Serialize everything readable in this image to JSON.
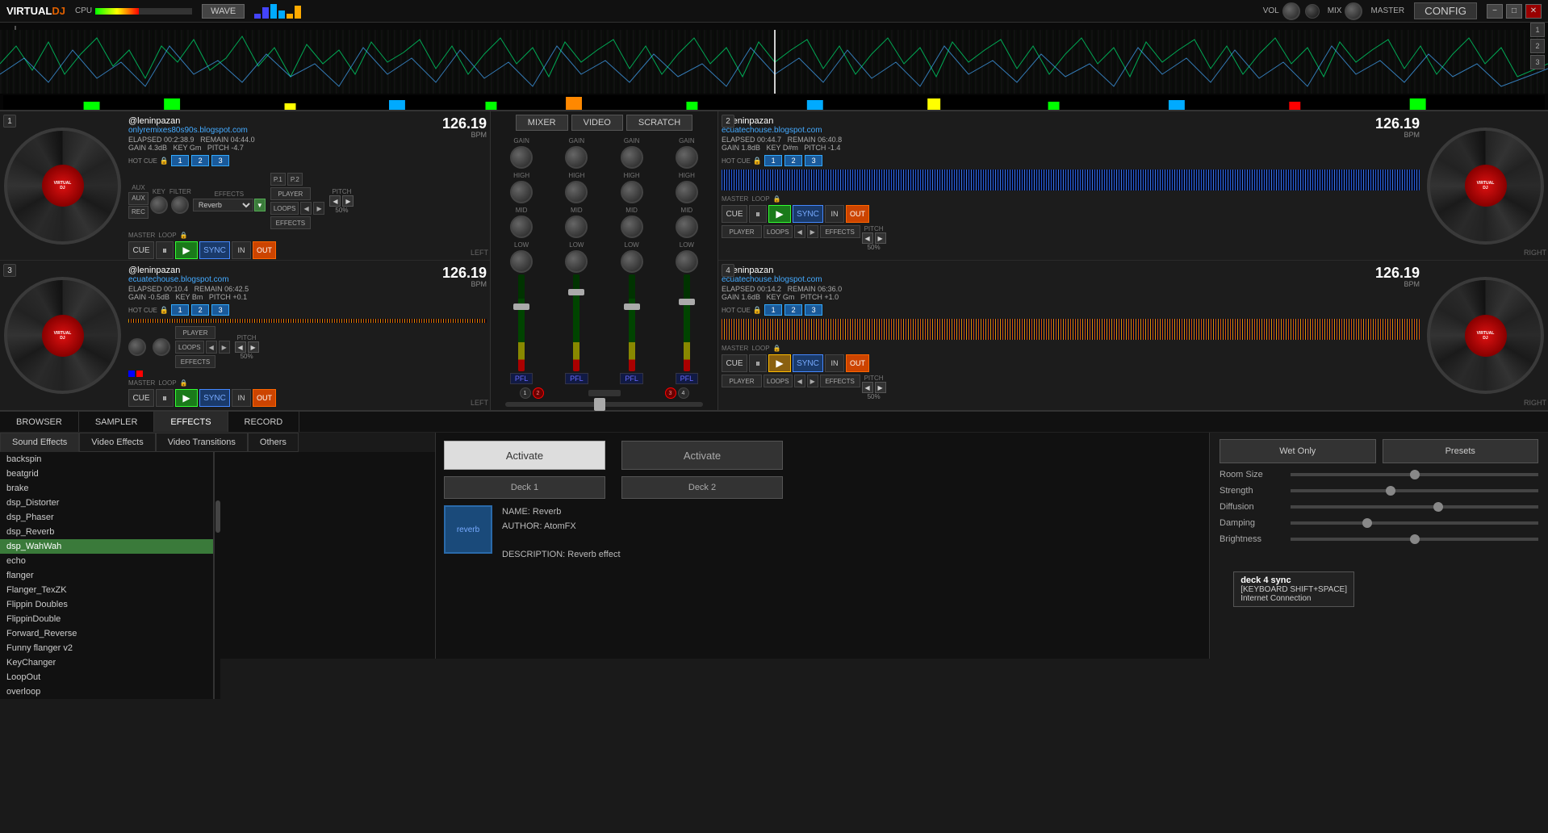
{
  "app": {
    "title": "VirtualDJ",
    "logo_part1": "VIRTUAL",
    "logo_part2": "DJ"
  },
  "topbar": {
    "cpu_label": "CPU",
    "wave_label": "WAVE",
    "vol_label": "VOL",
    "mix_label": "MIX",
    "master_label": "MASTER",
    "config_label": "CONFIG"
  },
  "mixer_tabs": {
    "mixer": "MIXER",
    "video": "VIDEO",
    "scratch": "SCRATCH"
  },
  "deck1": {
    "number": "1",
    "artist": "@leninpazan",
    "url": "onlyremixes80s90s.blogspot.com",
    "elapsed": "ELAPSED 00:2:38.9",
    "remain": "REMAIN 04:44.0",
    "gain": "GAIN 4.3dB",
    "key": "KEY Gm",
    "pitch": "PITCH -4.7",
    "bpm": "126.19",
    "bpm_unit": "BPM",
    "hot_cue": "HOT CUE",
    "hc1": "1",
    "hc2": "2",
    "hc3": "3",
    "effects_label": "EFFECTS",
    "effects_value": "Reverb",
    "label": "LEFT",
    "player_label": "PLAYER",
    "loops_label": "LOOPS",
    "effects_sub": "EFFECTS",
    "pitch_pct": "50%",
    "master_label": "MASTER",
    "loop_label": "LOOP",
    "cue_btn": "CUE",
    "in_btn": "IN",
    "out_btn": "OUT",
    "sync_btn": "SYNC",
    "p1_label": "P.1",
    "p2_label": "P.2",
    "key_label": "KEY",
    "filter_label": "FILTER",
    "aux_label": "AUX",
    "rec_label": "REC"
  },
  "deck2": {
    "number": "2",
    "artist": "@leninpazan",
    "url": "ecuatechouse.blogspot.com",
    "elapsed": "ELAPSED 00:44.7",
    "remain": "REMAIN 06:40.8",
    "gain": "GAIN 1.8dB",
    "key": "KEY D#m",
    "pitch": "PITCH -1.4",
    "bpm": "126.19",
    "bpm_unit": "BPM",
    "hot_cue": "HOT CUE",
    "hc1": "1",
    "hc2": "2",
    "hc3": "3",
    "label": "RIGHT",
    "player_label": "PLAYER",
    "loops_label": "LOOPS",
    "effects_sub": "EFFECTS",
    "pitch_pct": "50%",
    "master_label": "MASTER",
    "loop_label": "LOOP",
    "cue_btn": "CUE",
    "in_btn": "IN",
    "out_btn": "OUT",
    "sync_btn": "SYNC"
  },
  "deck3": {
    "number": "3",
    "artist": "@leninpazan",
    "url": "ecuatechouse.blogspot.com",
    "elapsed": "ELAPSED 00:10.4",
    "remain": "REMAIN 06:42.5",
    "gain": "GAIN -0.5dB",
    "key": "KEY Bm",
    "pitch": "PITCH +0.1",
    "bpm": "126.19",
    "bpm_unit": "BPM",
    "hot_cue": "HOT CUE",
    "hc1": "1",
    "hc2": "2",
    "hc3": "3",
    "label": "LEFT",
    "player_label": "PLAYER",
    "loops_label": "LOOPS",
    "effects_sub": "EFFECTS",
    "pitch_pct": "50%",
    "master_label": "MASTER",
    "loop_label": "LOOP",
    "cue_btn": "CUE",
    "in_btn": "IN",
    "out_btn": "OUT",
    "sync_btn": "SYNC"
  },
  "deck4": {
    "number": "4",
    "artist": "@leninpazan",
    "url": "ecuatechouse.blogspot.com",
    "elapsed": "ELAPSED 00:14.2",
    "remain": "REMAIN 06:36.0",
    "gain": "GAIN 1.6dB",
    "key": "KEY Gm",
    "pitch": "PITCH +1.0",
    "bpm": "126.19",
    "bpm_unit": "BPM",
    "hot_cue": "HOT CUE",
    "hc1": "1",
    "hc2": "2",
    "hc3": "3",
    "label": "RIGHT",
    "player_label": "PLAYER",
    "loops_label": "LOOPS",
    "effects_sub": "EFFECTS",
    "pitch_pct": "50%",
    "master_label": "MASTER",
    "loop_label": "LOOP",
    "cue_btn": "CUE",
    "in_btn": "IN",
    "out_btn": "OUT",
    "sync_btn": "SYNC"
  },
  "mixer": {
    "gain_label": "GAIN",
    "high_label": "HIGH",
    "mid_label": "MID",
    "low_label": "LOW",
    "pfl_label": "PFL",
    "ch1": "1",
    "ch2": "2",
    "ch3": "3",
    "ch4": "4"
  },
  "bottom_tabs": [
    {
      "label": "BROWSER",
      "active": false
    },
    {
      "label": "SAMPLER",
      "active": false
    },
    {
      "label": "EFFECTS",
      "active": true
    },
    {
      "label": "RECORD",
      "active": false
    }
  ],
  "effects_panel": {
    "tabs": [
      {
        "label": "Sound Effects",
        "active": true
      },
      {
        "label": "Video Effects",
        "active": false
      },
      {
        "label": "Video Transitions",
        "active": false
      },
      {
        "label": "Others",
        "active": false
      }
    ],
    "list": [
      "backspin",
      "beatgrid",
      "brake",
      "dsp_Distorter",
      "dsp_Phaser",
      "dsp_Reverb",
      "dsp_WahWah",
      "echo",
      "flanger",
      "Flanger_TexZK",
      "Flippin Doubles",
      "FlippinDouble",
      "Forward_Reverse",
      "Funny flanger v2",
      "KeyChanger",
      "LoopOut",
      "overloop"
    ],
    "active_effect": "dsp_WahWah",
    "activate_btn1": "Activate",
    "activate_btn2": "Activate",
    "deck1_btn": "Deck 1",
    "deck2_btn": "Deck 2",
    "effect_icon_label": "reverb",
    "effect_name": "NAME: Reverb",
    "effect_author": "AUTHOR: AtomFX",
    "effect_desc": "DESCRIPTION: Reverb effect",
    "wet_only_btn": "Wet Only",
    "presets_btn": "Presets",
    "params": [
      {
        "label": "Room Size",
        "value": 0.5
      },
      {
        "label": "Strength",
        "value": 0.4
      },
      {
        "label": "Diffusion",
        "value": 0.6
      },
      {
        "label": "Damping",
        "value": 0.3
      },
      {
        "label": "Brightness",
        "value": 0.5
      }
    ]
  },
  "tooltip": {
    "title": "deck 4 sync",
    "shortcut": "[KEYBOARD SHIFT+SPACE]",
    "extra": "Internet Connection"
  }
}
